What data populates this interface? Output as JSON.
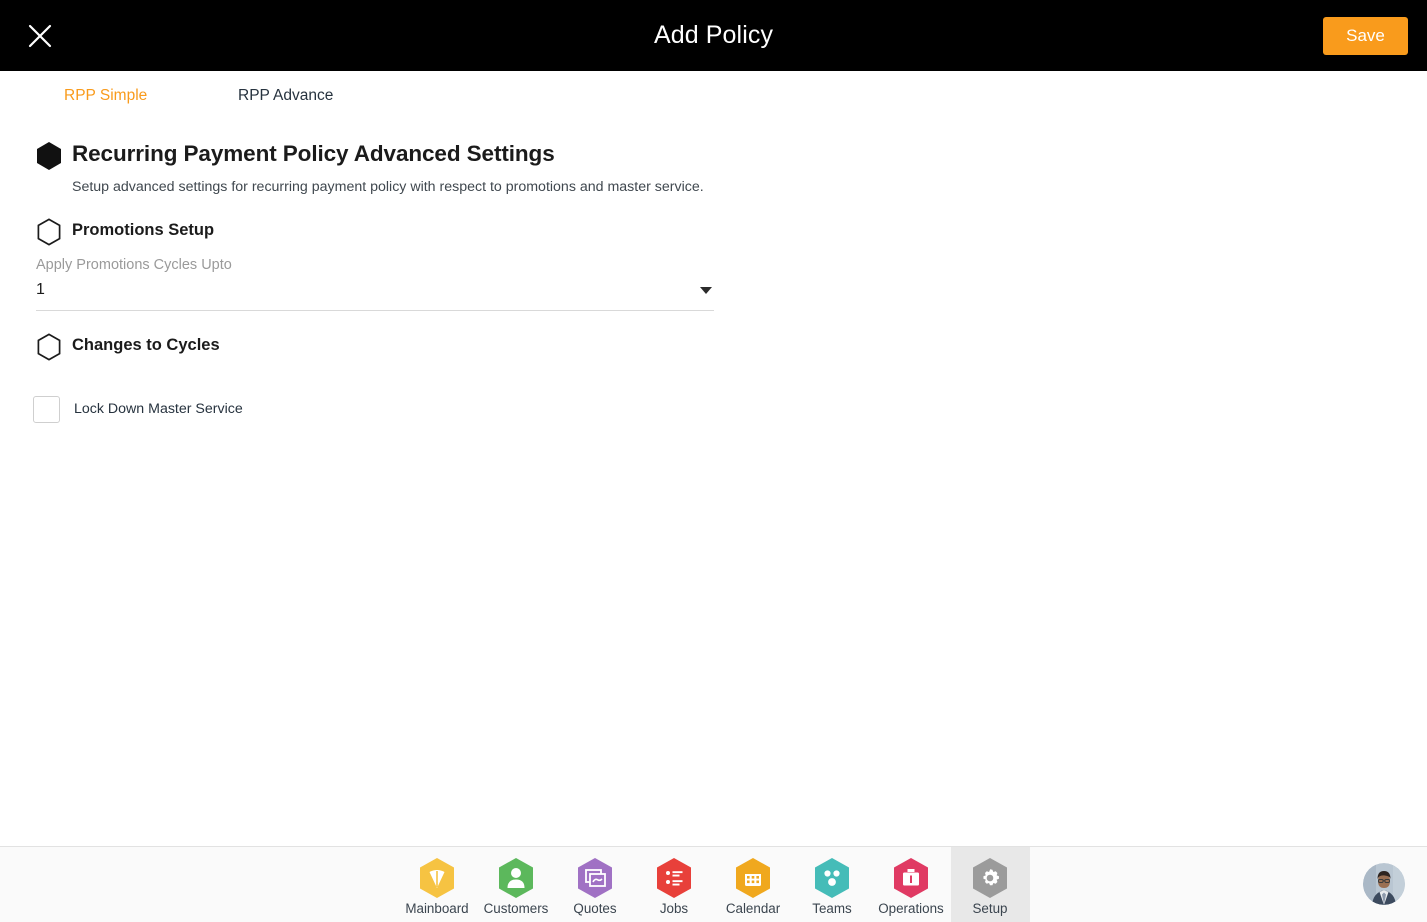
{
  "header": {
    "title": "Add Policy",
    "close_icon": "close-icon",
    "save_label": "Save",
    "accent_color": "#f99b1c",
    "background_color": "#000000"
  },
  "tabs": [
    {
      "label": "RPP Simple",
      "state": "highlighted"
    },
    {
      "label": "RPP Advance",
      "state": "indicated"
    }
  ],
  "main": {
    "section_title": "Recurring Payment Policy Advanced Settings",
    "section_subtitle": "Setup advanced settings for recurring payment policy with respect to promotions and master service.",
    "groups": [
      {
        "heading": "Promotions Setup"
      },
      {
        "heading": "Changes to Cycles"
      }
    ],
    "select": {
      "label": "Apply Promotions Cycles Upto",
      "value": "1",
      "caret_icon": "chevron-down-icon"
    },
    "checkbox": {
      "label": "Lock Down Master Service",
      "checked": false
    }
  },
  "bottom_nav": {
    "items": [
      {
        "label": "Mainboard",
        "icon": "mainboard-icon",
        "color": "#f6c342",
        "selected": false
      },
      {
        "label": "Customers",
        "icon": "person-icon",
        "color": "#5cb85c",
        "selected": false
      },
      {
        "label": "Quotes",
        "icon": "quotes-icon",
        "color": "#a071c4",
        "selected": false
      },
      {
        "label": "Jobs",
        "icon": "list-icon",
        "color": "#e8403a",
        "selected": false
      },
      {
        "label": "Calendar",
        "icon": "calendar-icon",
        "color": "#f0a81e",
        "selected": false
      },
      {
        "label": "Teams",
        "icon": "teams-icon",
        "color": "#45bcb8",
        "selected": false
      },
      {
        "label": "Operations",
        "icon": "briefcase-icon",
        "color": "#e03a63",
        "selected": false
      },
      {
        "label": "Setup",
        "icon": "gear-icon",
        "color": "#9b9b9b",
        "selected": true
      }
    ],
    "avatar": "user-avatar"
  }
}
